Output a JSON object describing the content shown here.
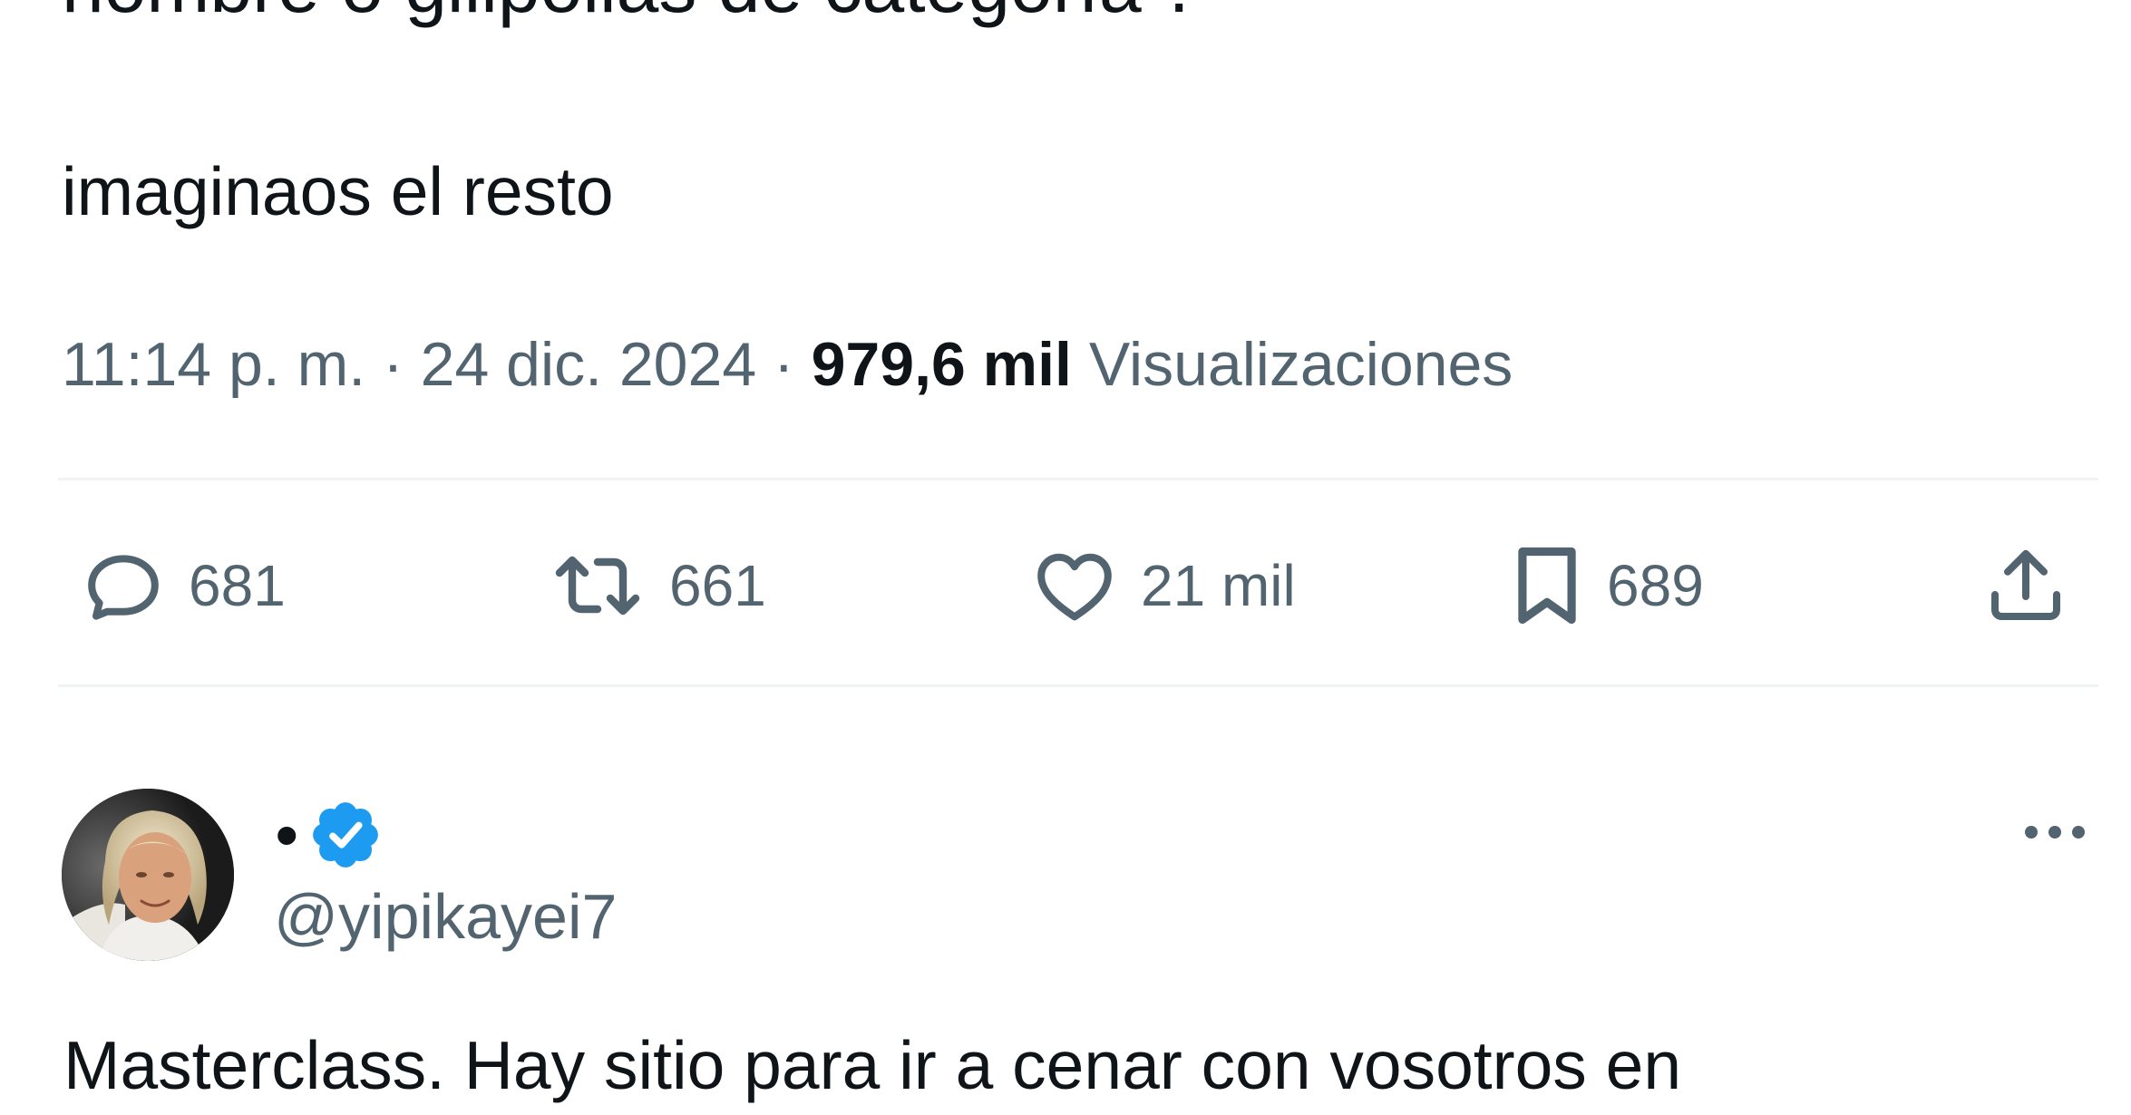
{
  "tweet": {
    "cut_line": "hombre o gilipollas de categoría\".",
    "text": "imaginaos el resto",
    "time": "11:14 p. m.",
    "separator": "·",
    "date": "24 dic. 2024",
    "views_count": "979,6 mil",
    "views_label": "Visualizaciones"
  },
  "actions": {
    "replies": "681",
    "retweets": "661",
    "likes": "21 mil",
    "bookmarks": "689"
  },
  "reply": {
    "display_name": "•",
    "handle": "@yipikayei7",
    "text": "Masterclass. Hay sitio para ir a cenar con vosotros en"
  },
  "colors": {
    "text_primary": "#0f1419",
    "text_secondary": "#536471",
    "divider": "#eff3f4",
    "verified": "#1d9bf0"
  },
  "icons": {
    "replies": "reply-bubble-icon",
    "retweets": "retweet-icon",
    "likes": "heart-icon",
    "bookmarks": "bookmark-icon",
    "share": "share-upload-icon",
    "verified": "verified-badge-icon",
    "more": "more-dots-icon"
  }
}
